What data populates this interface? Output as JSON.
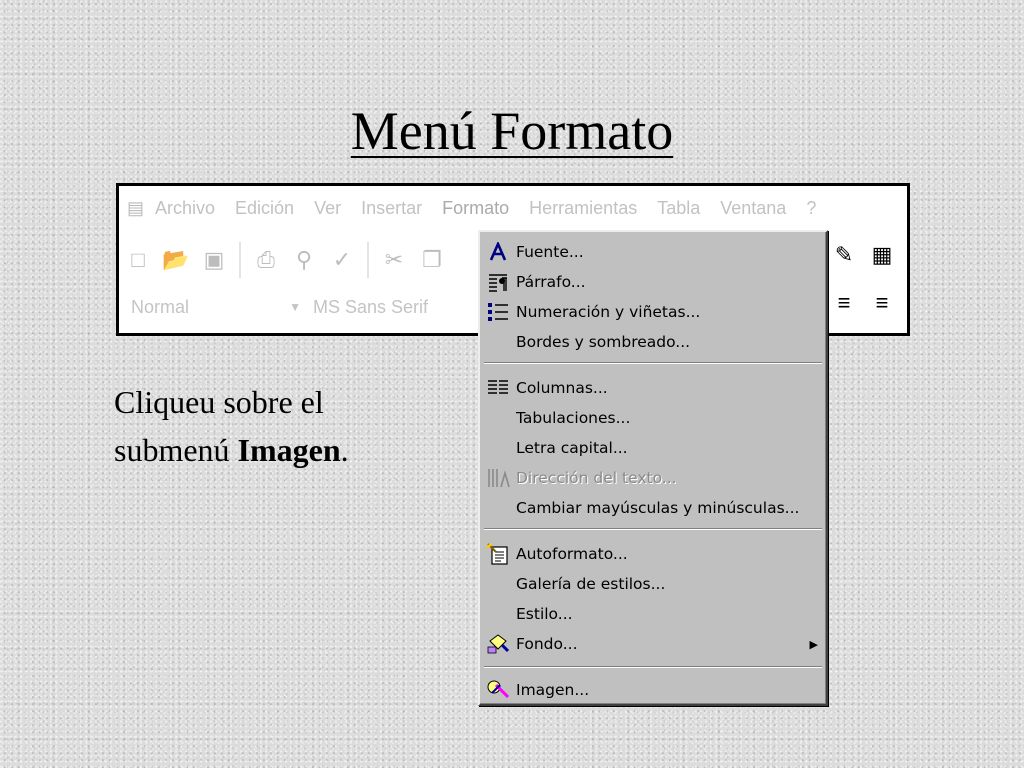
{
  "slide": {
    "title": "Menú Formato",
    "instruction_line1": "Cliqueu sobre el",
    "instruction_line2_prefix": "submenú ",
    "instruction_line2_bold": "Imagen",
    "instruction_line2_suffix": "."
  },
  "app": {
    "menubar": [
      "Archivo",
      "Edición",
      "Ver",
      "Insertar",
      "Formato",
      "Herramientas",
      "Tabla",
      "Ventana",
      "?"
    ],
    "style_combo": "Normal",
    "font_combo": "MS Sans Serif"
  },
  "format_menu": {
    "items": [
      {
        "label": "Fuente...",
        "icon": "font-a-icon"
      },
      {
        "label": "Párrafo...",
        "icon": "paragraph-icon"
      },
      {
        "label": "Numeración y viñetas...",
        "icon": "bullets-icon"
      },
      {
        "label": "Bordes y sombreado...",
        "icon": ""
      },
      {
        "label": "Columnas...",
        "icon": "columns-icon"
      },
      {
        "label": "Tabulaciones...",
        "icon": ""
      },
      {
        "label": "Letra capital...",
        "icon": ""
      },
      {
        "label": "Dirección del texto...",
        "icon": "text-direction-icon",
        "disabled": true
      },
      {
        "label": "Cambiar mayúsculas y minúsculas...",
        "icon": ""
      },
      {
        "label": "Autoformato...",
        "icon": "autoformat-icon"
      },
      {
        "label": "Galería de estilos...",
        "icon": ""
      },
      {
        "label": "Estilo...",
        "icon": ""
      },
      {
        "label": "Fondo...",
        "icon": "background-icon",
        "submenu": true
      },
      {
        "label": "Imagen...",
        "icon": "image-icon"
      }
    ]
  },
  "colors": {
    "slide_bg": "#dcdcdc",
    "menu_bg": "#c0c0c0",
    "disabled_text": "#8a8a8a"
  }
}
